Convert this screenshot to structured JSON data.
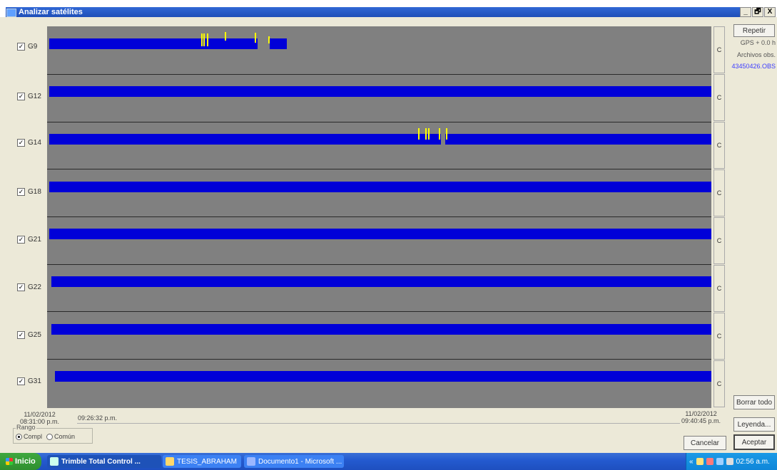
{
  "window": {
    "title": "Analizar satélites",
    "buttons": [
      "_",
      "🗗",
      "X"
    ]
  },
  "satellites": [
    {
      "id": "G9",
      "checked": true
    },
    {
      "id": "G12",
      "checked": true
    },
    {
      "id": "G14",
      "checked": true
    },
    {
      "id": "G18",
      "checked": true
    },
    {
      "id": "G21",
      "checked": true
    },
    {
      "id": "G22",
      "checked": true
    },
    {
      "id": "G25",
      "checked": true
    },
    {
      "id": "G31",
      "checked": true
    }
  ],
  "row_button_label": "C",
  "colors": {
    "plot_background": "#808080",
    "track": "#0000d8",
    "cycle_slip": "#ffff00"
  },
  "right_panel": {
    "repeat_button": "Repetir",
    "gps_offset": "GPS + 0.0 h",
    "obs_files_label": "Archivos obs.",
    "obs_file": "43450426.OBS",
    "delete_all_button": "Borrar todo",
    "legend_button": "Leyenda...",
    "accept_button": "Aceptar"
  },
  "cancel_button": "Cancelar",
  "time": {
    "start_date": "11/02/2012",
    "start_time": "08:31:00 p.m.",
    "cursor_time": "09:26:32 p.m.",
    "end_date": "11/02/2012",
    "end_time": "09:40:45 p.m."
  },
  "range": {
    "label": "Rango",
    "options": [
      {
        "label": "Compl",
        "selected": true
      },
      {
        "label": "Común",
        "selected": false
      }
    ]
  },
  "taskbar": {
    "start_label": "Inicio",
    "tasks": [
      {
        "label": "Trimble Total Control ...",
        "active": true
      },
      {
        "label": "TESIS_ABRAHAM",
        "active": false
      },
      {
        "label": "Documento1 - Microsoft ...",
        "active": false
      }
    ],
    "tray_expand": "«",
    "clock": "02:56 a.m."
  }
}
